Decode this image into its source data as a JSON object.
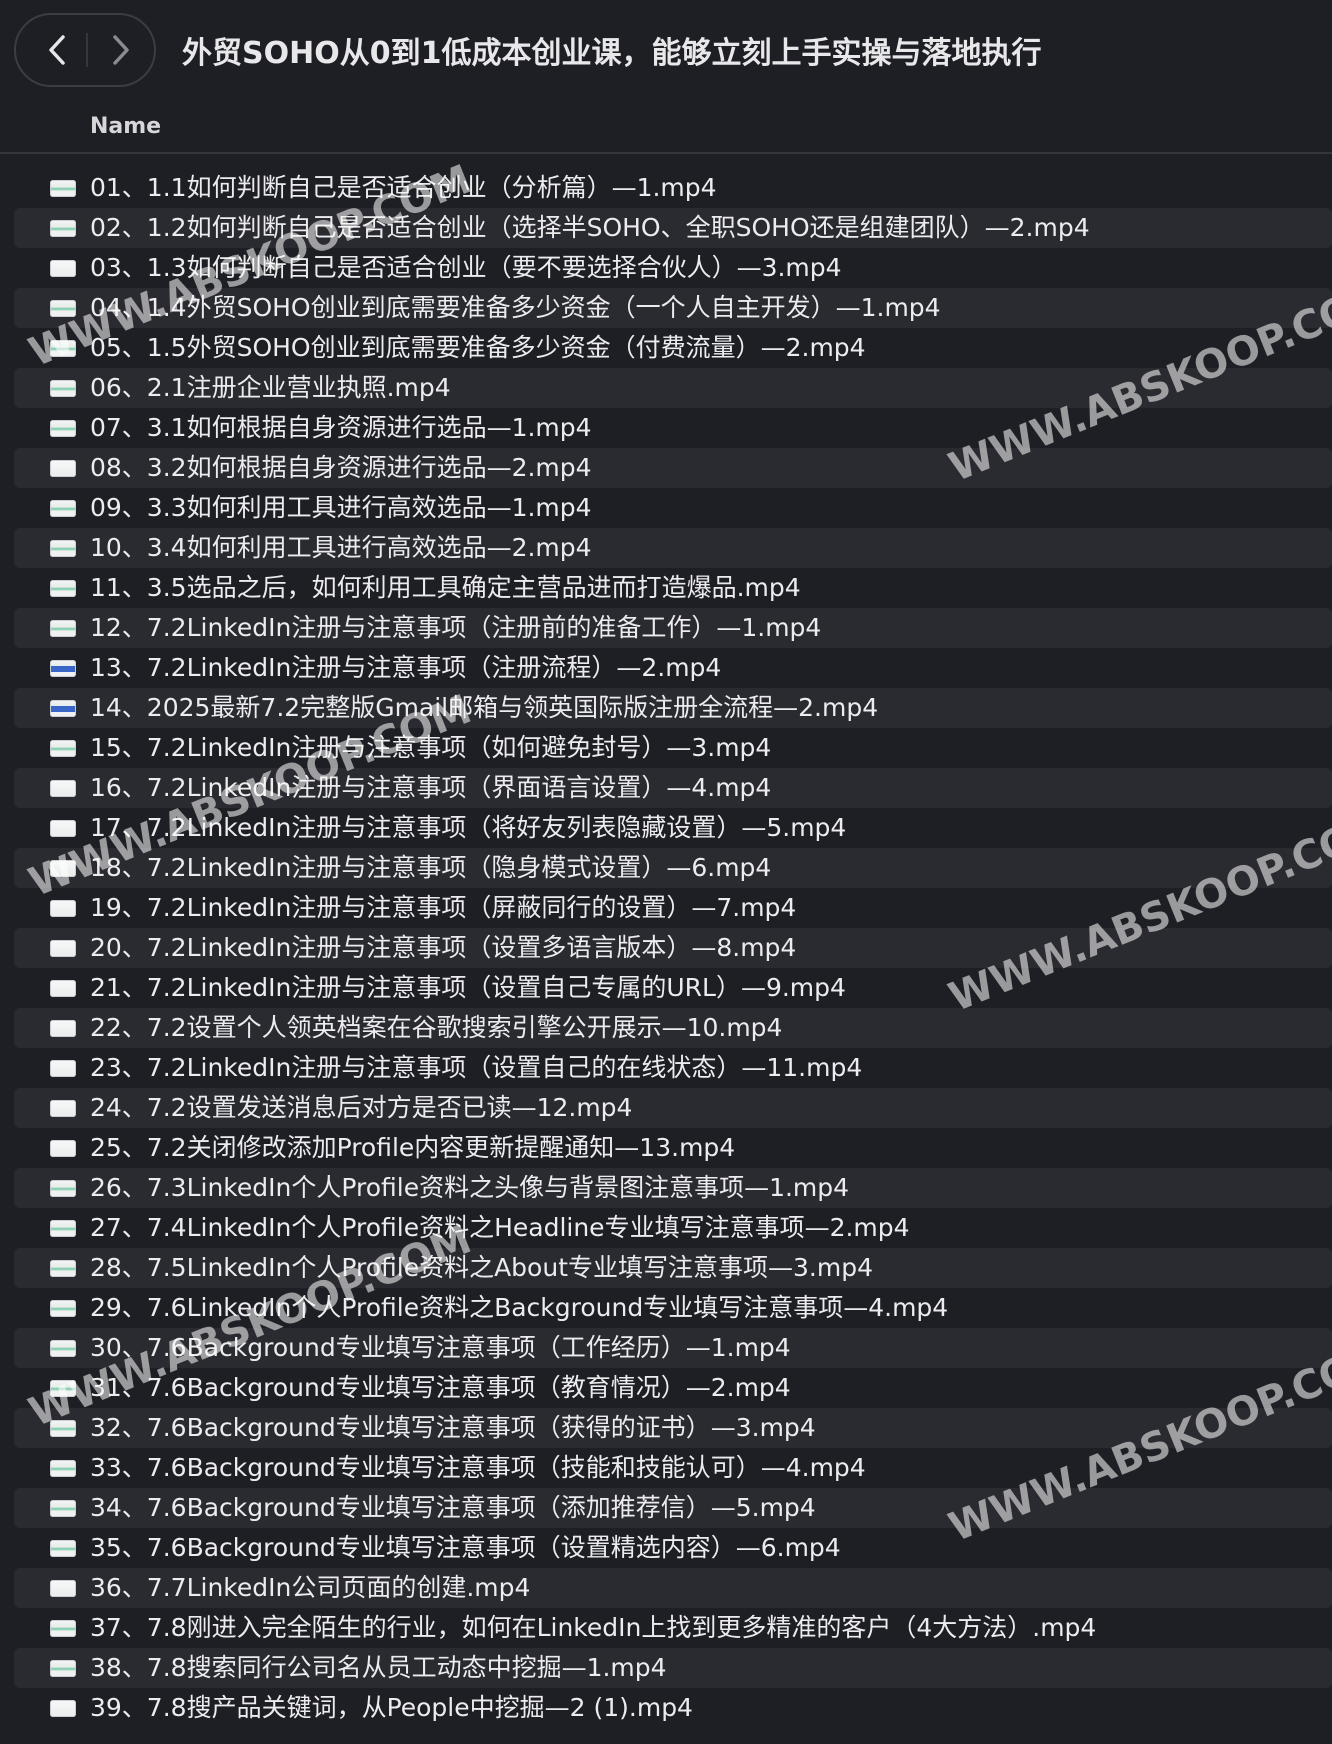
{
  "header": {
    "title": "外贸SOHO从0到1低成本创业课，能够立刻上手实操与落地执行",
    "back_icon": "chevron-left-icon",
    "forward_icon": "chevron-right-icon"
  },
  "columns": {
    "name": "Name"
  },
  "watermark": "WWW.ABSKOOP.COM",
  "files": [
    {
      "name": "01、1.1如何判断自己是否适合创业（分析篇）—1.mp4",
      "icon": "video-file-icon"
    },
    {
      "name": "02、1.2如何判断自己是否适合创业（选择半SOHO、全职SOHO还是组建团队）—2.mp4",
      "icon": "video-file-icon"
    },
    {
      "name": "03、1.3如何判断自己是否适合创业（要不要选择合伙人）—3.mp4",
      "icon": "video-file-icon"
    },
    {
      "name": "04、1.4外贸SOHO创业到底需要准备多少资金（一个人自主开发）—1.mp4",
      "icon": "video-file-icon"
    },
    {
      "name": "05、1.5外贸SOHO创业到底需要准备多少资金（付费流量）—2.mp4",
      "icon": "video-file-icon"
    },
    {
      "name": "06、2.1注册企业营业执照.mp4",
      "icon": "video-file-icon"
    },
    {
      "name": "07、3.1如何根据自身资源进行选品—1.mp4",
      "icon": "video-file-icon"
    },
    {
      "name": "08、3.2如何根据自身资源进行选品—2.mp4",
      "icon": "video-file-icon"
    },
    {
      "name": "09、3.3如何利用工具进行高效选品—1.mp4",
      "icon": "video-file-icon"
    },
    {
      "name": "10、3.4如何利用工具进行高效选品—2.mp4",
      "icon": "video-file-icon"
    },
    {
      "name": "11、3.5选品之后，如何利用工具确定主营品进而打造爆品.mp4",
      "icon": "video-file-icon"
    },
    {
      "name": "12、7.2LinkedIn注册与注意事项（注册前的准备工作）—1.mp4",
      "icon": "video-file-icon"
    },
    {
      "name": "13、7.2LinkedIn注册与注意事项（注册流程）—2.mp4",
      "icon": "video-file-icon"
    },
    {
      "name": "14、2025最新7.2完整版Gmail邮箱与领英国际版注册全流程—2.mp4",
      "icon": "video-file-icon"
    },
    {
      "name": "15、7.2LinkedIn注册与注意事项（如何避免封号）—3.mp4",
      "icon": "video-file-icon"
    },
    {
      "name": "16、7.2LinkedIn注册与注意事项（界面语言设置）—4.mp4",
      "icon": "video-file-icon"
    },
    {
      "name": "17、7.2LinkedIn注册与注意事项（将好友列表隐藏设置）—5.mp4",
      "icon": "video-file-icon"
    },
    {
      "name": "18、7.2LinkedIn注册与注意事项（隐身模式设置）—6.mp4",
      "icon": "video-file-icon"
    },
    {
      "name": "19、7.2LinkedIn注册与注意事项（屏蔽同行的设置）—7.mp4",
      "icon": "video-file-icon"
    },
    {
      "name": "20、7.2LinkedIn注册与注意事项（设置多语言版本）—8.mp4",
      "icon": "video-file-icon"
    },
    {
      "name": "21、7.2LinkedIn注册与注意事项（设置自己专属的URL）—9.mp4",
      "icon": "video-file-icon"
    },
    {
      "name": "22、7.2设置个人领英档案在谷歌搜索引擎公开展示—10.mp4",
      "icon": "video-file-icon"
    },
    {
      "name": "23、7.2LinkedIn注册与注意事项（设置自己的在线状态）—11.mp4",
      "icon": "video-file-icon"
    },
    {
      "name": "24、7.2设置发送消息后对方是否已读—12.mp4",
      "icon": "video-file-icon"
    },
    {
      "name": "25、7.2关闭修改添加Profile内容更新提醒通知—13.mp4",
      "icon": "video-file-icon"
    },
    {
      "name": "26、7.3LinkedIn个人Profile资料之头像与背景图注意事项—1.mp4",
      "icon": "video-file-icon"
    },
    {
      "name": "27、7.4LinkedIn个人Profile资料之Headline专业填写注意事项—2.mp4",
      "icon": "video-file-icon"
    },
    {
      "name": "28、7.5LinkedIn个人Profile资料之About专业填写注意事项—3.mp4",
      "icon": "video-file-icon"
    },
    {
      "name": "29、7.6LinkedIn个人Profile资料之Background专业填写注意事项—4.mp4",
      "icon": "video-file-icon"
    },
    {
      "name": "30、7.6Background专业填写注意事项（工作经历）—1.mp4",
      "icon": "video-file-icon"
    },
    {
      "name": "31、7.6Background专业填写注意事项（教育情况）—2.mp4",
      "icon": "video-file-icon"
    },
    {
      "name": "32、7.6Background专业填写注意事项（获得的证书）—3.mp4",
      "icon": "video-file-icon"
    },
    {
      "name": "33、7.6Background专业填写注意事项（技能和技能认可）—4.mp4",
      "icon": "video-file-icon"
    },
    {
      "name": "34、7.6Background专业填写注意事项（添加推荐信）—5.mp4",
      "icon": "video-file-icon"
    },
    {
      "name": "35、7.6Background专业填写注意事项（设置精选内容）—6.mp4",
      "icon": "video-file-icon"
    },
    {
      "name": "36、7.7LinkedIn公司页面的创建.mp4",
      "icon": "video-file-icon"
    },
    {
      "name": "37、7.8刚进入完全陌生的行业，如何在LinkedIn上找到更多精准的客户（4大方法）.mp4",
      "icon": "video-file-icon"
    },
    {
      "name": "38、7.8搜索同行公司名从员工动态中挖掘—1.mp4",
      "icon": "video-file-icon"
    },
    {
      "name": "39、7.8搜产品关键词，从People中挖掘—2 (1).mp4",
      "icon": "video-file-icon"
    }
  ]
}
